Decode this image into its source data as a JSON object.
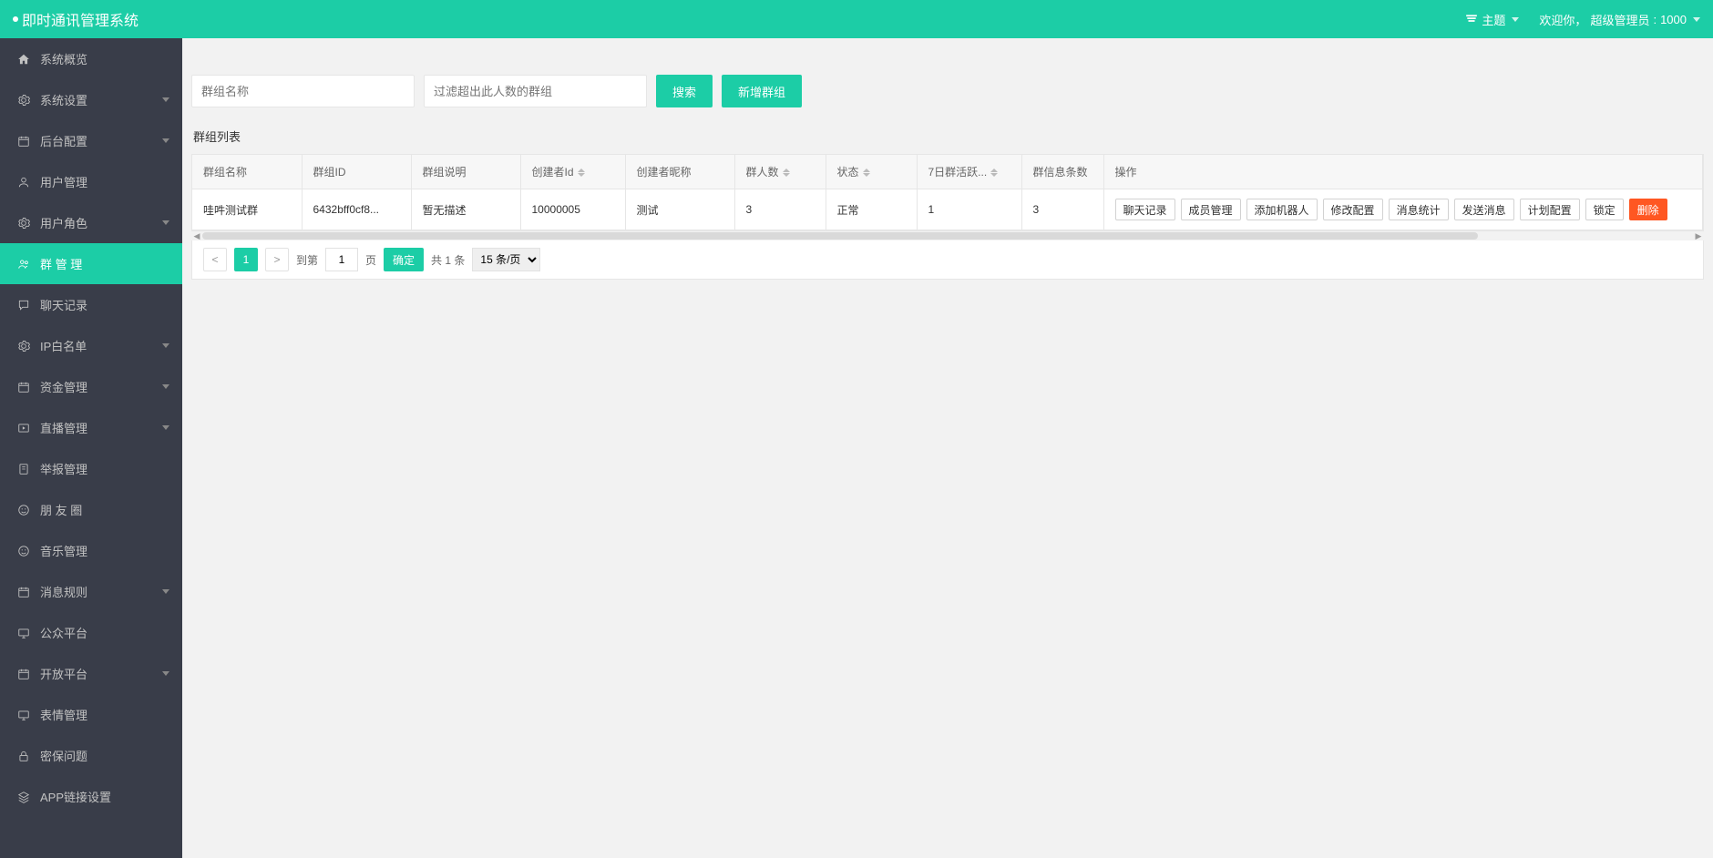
{
  "header": {
    "title": "即时通讯管理系统",
    "theme_label": "主题",
    "welcome_prefix": "欢迎你，",
    "user_role": "超级管理员",
    "user_id": "1000"
  },
  "sidebar": {
    "items": [
      {
        "icon": "home",
        "label": "系统概览",
        "has_sub": false
      },
      {
        "icon": "gear",
        "label": "系统设置",
        "has_sub": true
      },
      {
        "icon": "calendar",
        "label": "后台配置",
        "has_sub": true
      },
      {
        "icon": "user",
        "label": "用户管理",
        "has_sub": false
      },
      {
        "icon": "gear",
        "label": "用户角色",
        "has_sub": true
      },
      {
        "icon": "group",
        "label": "群 管 理",
        "has_sub": false,
        "active": true
      },
      {
        "icon": "chat",
        "label": "聊天记录",
        "has_sub": false
      },
      {
        "icon": "gear",
        "label": "IP白名单",
        "has_sub": true
      },
      {
        "icon": "calendar",
        "label": "资金管理",
        "has_sub": true
      },
      {
        "icon": "play",
        "label": "直播管理",
        "has_sub": true
      },
      {
        "icon": "report",
        "label": "举报管理",
        "has_sub": false
      },
      {
        "icon": "smile",
        "label": "朋 友 圈",
        "has_sub": false
      },
      {
        "icon": "smile",
        "label": "音乐管理",
        "has_sub": false
      },
      {
        "icon": "calendar",
        "label": "消息规则",
        "has_sub": true
      },
      {
        "icon": "monitor",
        "label": "公众平台",
        "has_sub": false
      },
      {
        "icon": "calendar",
        "label": "开放平台",
        "has_sub": true
      },
      {
        "icon": "monitor",
        "label": "表情管理",
        "has_sub": false
      },
      {
        "icon": "lock",
        "label": "密保问题",
        "has_sub": false
      },
      {
        "icon": "layers",
        "label": "APP链接设置",
        "has_sub": false
      }
    ]
  },
  "toolbar": {
    "name_placeholder": "群组名称",
    "filter_placeholder": "过滤超出此人数的群组",
    "search_label": "搜索",
    "add_label": "新增群组"
  },
  "table": {
    "title": "群组列表",
    "columns": [
      "群组名称",
      "群组ID",
      "群组说明",
      "创建者Id",
      "创建者昵称",
      "群人数",
      "状态",
      "7日群活跃...",
      "群信息条数",
      "操作"
    ],
    "sortable": [
      false,
      false,
      false,
      true,
      false,
      true,
      true,
      true,
      false,
      false
    ],
    "rows": [
      {
        "cells": [
          "哇吽测试群",
          "6432bff0cf8...",
          "暂无描述",
          "10000005",
          "测试",
          "3",
          "正常",
          "1",
          "3"
        ],
        "actions": [
          "聊天记录",
          "成员管理",
          "添加机器人",
          "修改配置",
          "消息统计",
          "发送消息",
          "计划配置",
          "锁定",
          "删除"
        ]
      }
    ]
  },
  "pager": {
    "current": "1",
    "goto_label": "到第",
    "goto_value": "1",
    "goto_suffix": "页",
    "confirm_label": "确定",
    "total_text": "共 1 条",
    "page_size_options": [
      "15 条/页"
    ],
    "page_size_selected": "15 条/页"
  }
}
